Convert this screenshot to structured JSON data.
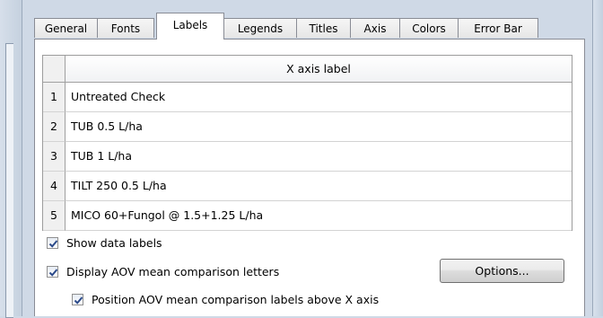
{
  "tabs": [
    {
      "label": "General",
      "active": false
    },
    {
      "label": "Fonts",
      "active": false
    },
    {
      "label": "Labels",
      "active": true
    },
    {
      "label": "Legends",
      "active": false
    },
    {
      "label": "Titles",
      "active": false
    },
    {
      "label": "Axis",
      "active": false
    },
    {
      "label": "Colors",
      "active": false
    },
    {
      "label": "Error Bar",
      "active": false
    }
  ],
  "grid": {
    "header": "X axis label",
    "rows": [
      {
        "num": "1",
        "label": "Untreated Check"
      },
      {
        "num": "2",
        "label": "TUB 0.5 L/ha"
      },
      {
        "num": "3",
        "label": "TUB 1 L/ha"
      },
      {
        "num": "4",
        "label": "TILT 250 0.5 L/ha"
      },
      {
        "num": "5",
        "label": "MICO 60+Fungol @ 1.5+1.25 L/ha"
      }
    ]
  },
  "options": {
    "show_data_labels": {
      "label": "Show data labels",
      "checked": true
    },
    "display_aov": {
      "label": "Display AOV mean comparison letters",
      "checked": true
    },
    "position_aov": {
      "label": "Position AOV mean comparison labels above X axis",
      "checked": true
    }
  },
  "options_button": {
    "label": "Options..."
  }
}
